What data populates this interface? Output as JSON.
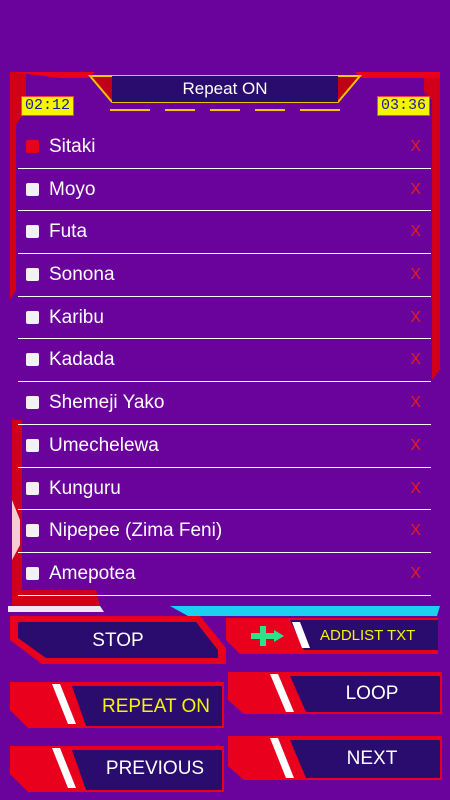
{
  "header": {
    "repeat_status": "Repeat ON",
    "time_elapsed": "02:12",
    "time_total": "03:36"
  },
  "playlist": {
    "tracks": [
      {
        "title": "Sitaki",
        "remove": "X",
        "active": true
      },
      {
        "title": "Moyo",
        "remove": "X",
        "active": false
      },
      {
        "title": "Futa",
        "remove": "X",
        "active": false
      },
      {
        "title": "Sonona",
        "remove": "X",
        "active": false
      },
      {
        "title": "Karibu",
        "remove": "X",
        "active": false
      },
      {
        "title": "Kadada",
        "remove": "X",
        "active": false
      },
      {
        "title": "Shemeji Yako",
        "remove": "X",
        "active": false
      },
      {
        "title": "Umechelewa",
        "remove": "X",
        "active": false
      },
      {
        "title": "Kunguru",
        "remove": "X",
        "active": false
      },
      {
        "title": "Nipepee (Zima Feni)",
        "remove": "X",
        "active": false
      },
      {
        "title": "Amepotea",
        "remove": "X",
        "active": false
      }
    ]
  },
  "controls": {
    "stop_label": "STOP",
    "addlist_label": "ADDLIST TXT",
    "repeat_label": "REPEAT ON",
    "loop_label": "LOOP",
    "previous_label": "PREVIOUS",
    "next_label": "NEXT"
  },
  "colors": {
    "background": "#6a039c",
    "frame_red": "#e8001c",
    "button_navy": "#2a0c6e",
    "accent_yellow": "#f5f500",
    "accent_cyan": "#1ad1f0",
    "accent_green": "#2fe08a"
  },
  "icons": {
    "add": "add-to-playlist-icon"
  }
}
